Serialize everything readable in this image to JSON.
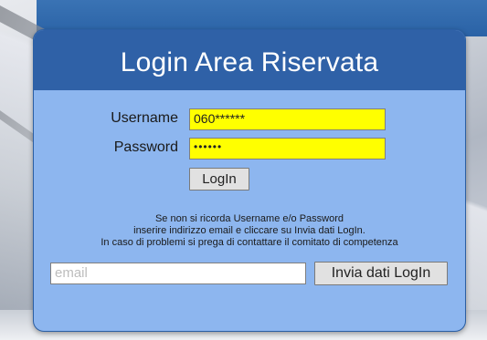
{
  "login": {
    "title": "Login Area Riservata",
    "username_label": "Username",
    "username_value": "060******",
    "password_label": "Password",
    "password_value": "••••••",
    "login_button": "LogIn",
    "help_line1": "Se non si ricorda Username e/o Password",
    "help_line2": "inserire indirizzo email e cliccare su Invia dati LogIn.",
    "help_line3": "In caso di problemi si prega di contattare il comitato di competenza",
    "email_placeholder": "email",
    "send_button": "Invia dati LogIn"
  },
  "colors": {
    "panel_bg": "#8db6ef",
    "header_bg": "#2f61a7",
    "field_highlight": "#ffff00"
  }
}
